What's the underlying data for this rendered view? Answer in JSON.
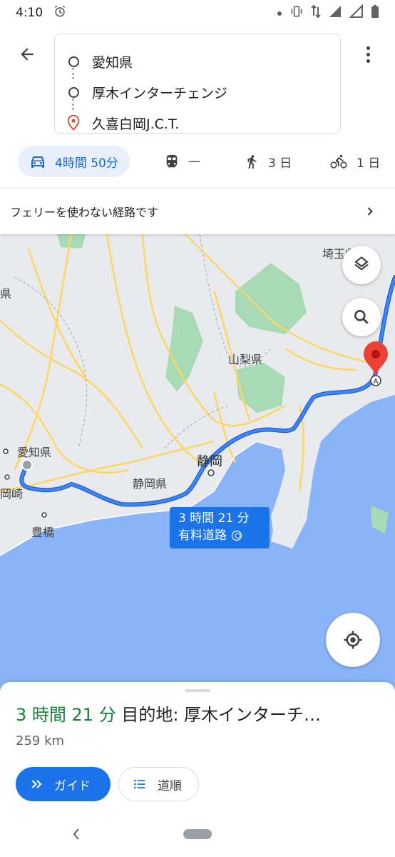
{
  "status_bar": {
    "time": "4:10",
    "icons": [
      "alarm-icon",
      "dot-icon",
      "vibrate-icon",
      "data-arrows-icon",
      "signal-icon",
      "signal-empty-icon",
      "battery-icon"
    ]
  },
  "header": {
    "back_icon": "arrow-left-icon",
    "more_icon": "more-vert-icon",
    "origin": "愛知県",
    "waypoint": "厚木インターチェンジ",
    "destination": "久喜白岡J.C.T."
  },
  "modes": [
    {
      "name": "drive",
      "icon": "car-icon",
      "label": "4時間 50分",
      "active": true
    },
    {
      "name": "transit",
      "icon": "train-icon",
      "label": "—",
      "active": false
    },
    {
      "name": "walk",
      "icon": "walk-icon",
      "label": "3 日",
      "active": false
    },
    {
      "name": "bike",
      "icon": "bike-icon",
      "label": "1 日",
      "active": false
    }
  ],
  "notice": {
    "text": "フェリーを使わない経路です",
    "icon": "chevron-right-icon"
  },
  "map": {
    "labels": {
      "saitama": "埼玉県",
      "yamanashi": "山梨県",
      "aichi": "愛知県",
      "shizuoka_city": "静岡",
      "shizuoka_pref": "静岡県",
      "okazaki": "岡崎",
      "toyohashi": "豊橋",
      "left_edge": "県"
    },
    "route_badge": {
      "duration": "3 時間 21 分",
      "type": "有料道路"
    },
    "colors": {
      "route": "#4285f4",
      "water": "#8ab4f8",
      "park": "#a8dab5",
      "road": "#fdd663",
      "land": "#e8eaed",
      "pin": "#ea4335"
    }
  },
  "sheet": {
    "duration": "3 時間 21 分",
    "destination_text": " 目的地: 厚木インターチ…",
    "distance": "259 km",
    "guide_label": "ガイド",
    "steps_label": "道順"
  },
  "navbar": {
    "back_icon": "nav-back-icon",
    "home_icon": "home-pill-icon"
  }
}
